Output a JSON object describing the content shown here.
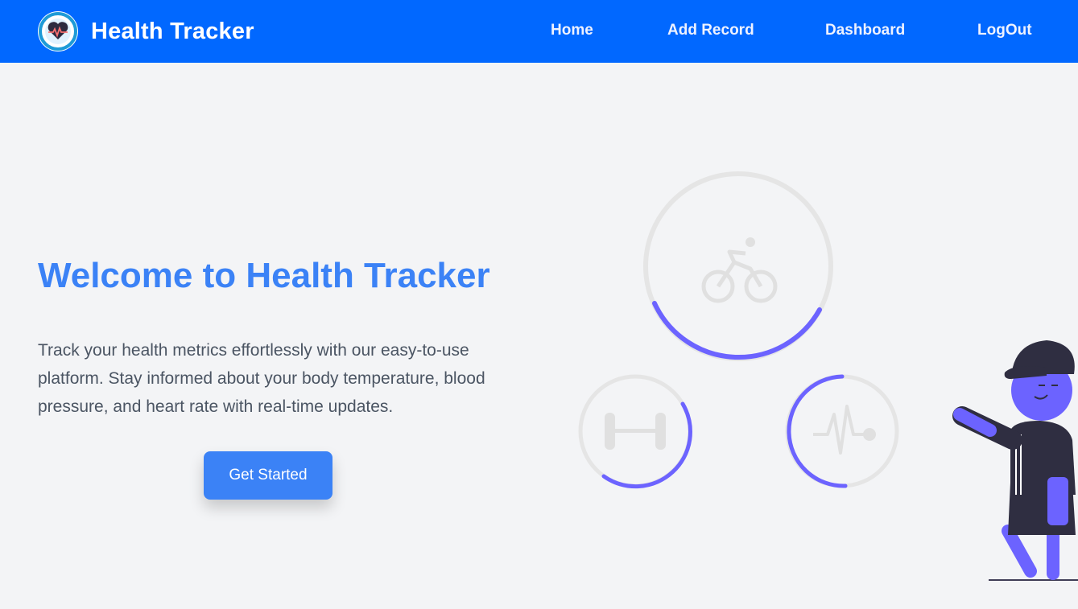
{
  "header": {
    "brand": "Health Tracker",
    "logo_icon": "heart-pulse-icon",
    "nav": [
      {
        "label": "Home"
      },
      {
        "label": "Add Record"
      },
      {
        "label": "Dashboard"
      },
      {
        "label": "LogOut"
      }
    ]
  },
  "hero": {
    "title": "Welcome to Health Tracker",
    "description": "Track your health metrics effortlessly with our easy-to-use platform. Stay informed about your body temperature, blood pressure, and heart rate with real-time updates.",
    "cta_label": "Get Started"
  },
  "illustration": {
    "icons": [
      "cycling-icon",
      "dumbbell-icon",
      "heartbeat-icon"
    ]
  },
  "colors": {
    "navbar": "#0168ff",
    "primary": "#3b82f6",
    "accent": "#6c63ff",
    "background": "#f3f4f6"
  }
}
